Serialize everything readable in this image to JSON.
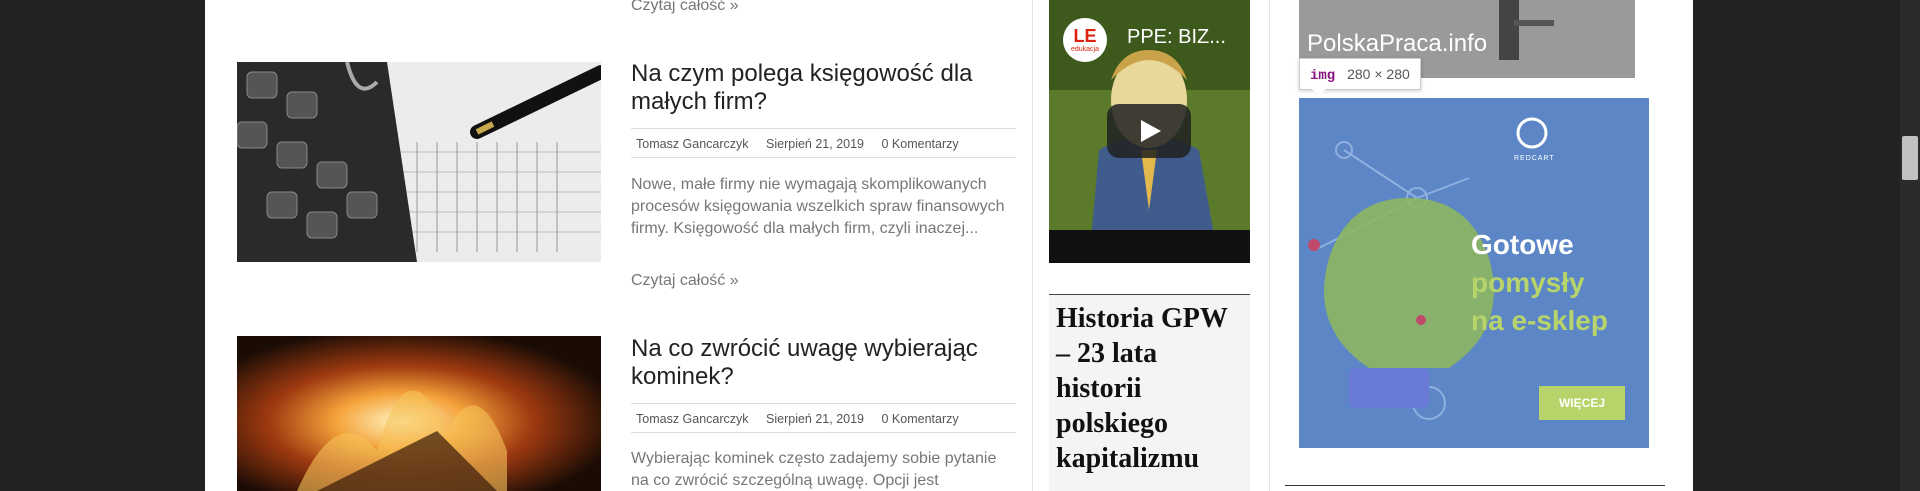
{
  "posts": [
    {
      "readmore": "Czytaj całość  »"
    },
    {
      "title": "Na czym polega księgowość dla małych firm?",
      "author": "Tomasz Gancarczyk",
      "date": "Sierpień 21, 2019",
      "comments": "0 Komentarzy",
      "excerpt": "Nowe, małe firmy nie wymagają skomplikowanych procesów księgowania wszelkich spraw finansowych firmy. Księgowość dla małych firm, czyli inaczej...",
      "readmore": "Czytaj całość  »"
    },
    {
      "title": "Na co zwrócić uwagę wybierając kominek?",
      "author": "Tomasz Gancarczyk",
      "date": "Sierpień 21, 2019",
      "comments": "0 Komentarzy",
      "excerpt": "Wybierając kominek często zadajemy sobie pytanie na co zwrócić szczególną uwagę. Opcji jest"
    }
  ],
  "video": {
    "title": "PPE: BIZ...",
    "channel_logo_text": "LE",
    "channel_sub": "edukacja"
  },
  "widget": {
    "title": "Historia GPW – 23 lata historii polskiego kapitalizmu"
  },
  "banner_top": {
    "text": "PolskaPraca.info"
  },
  "ad": {
    "brand": "REDCART",
    "line1": "Gotowe",
    "line2": "pomysły",
    "line3": "na e-sklep",
    "button": "WIĘCEJ"
  },
  "devtools_tooltip": {
    "tag": "img",
    "size": "280 × 280"
  },
  "colors": {
    "ad_bg": "#5c86c6",
    "ad_green": "#b7d46b",
    "tooltip_tag": "#881280"
  }
}
